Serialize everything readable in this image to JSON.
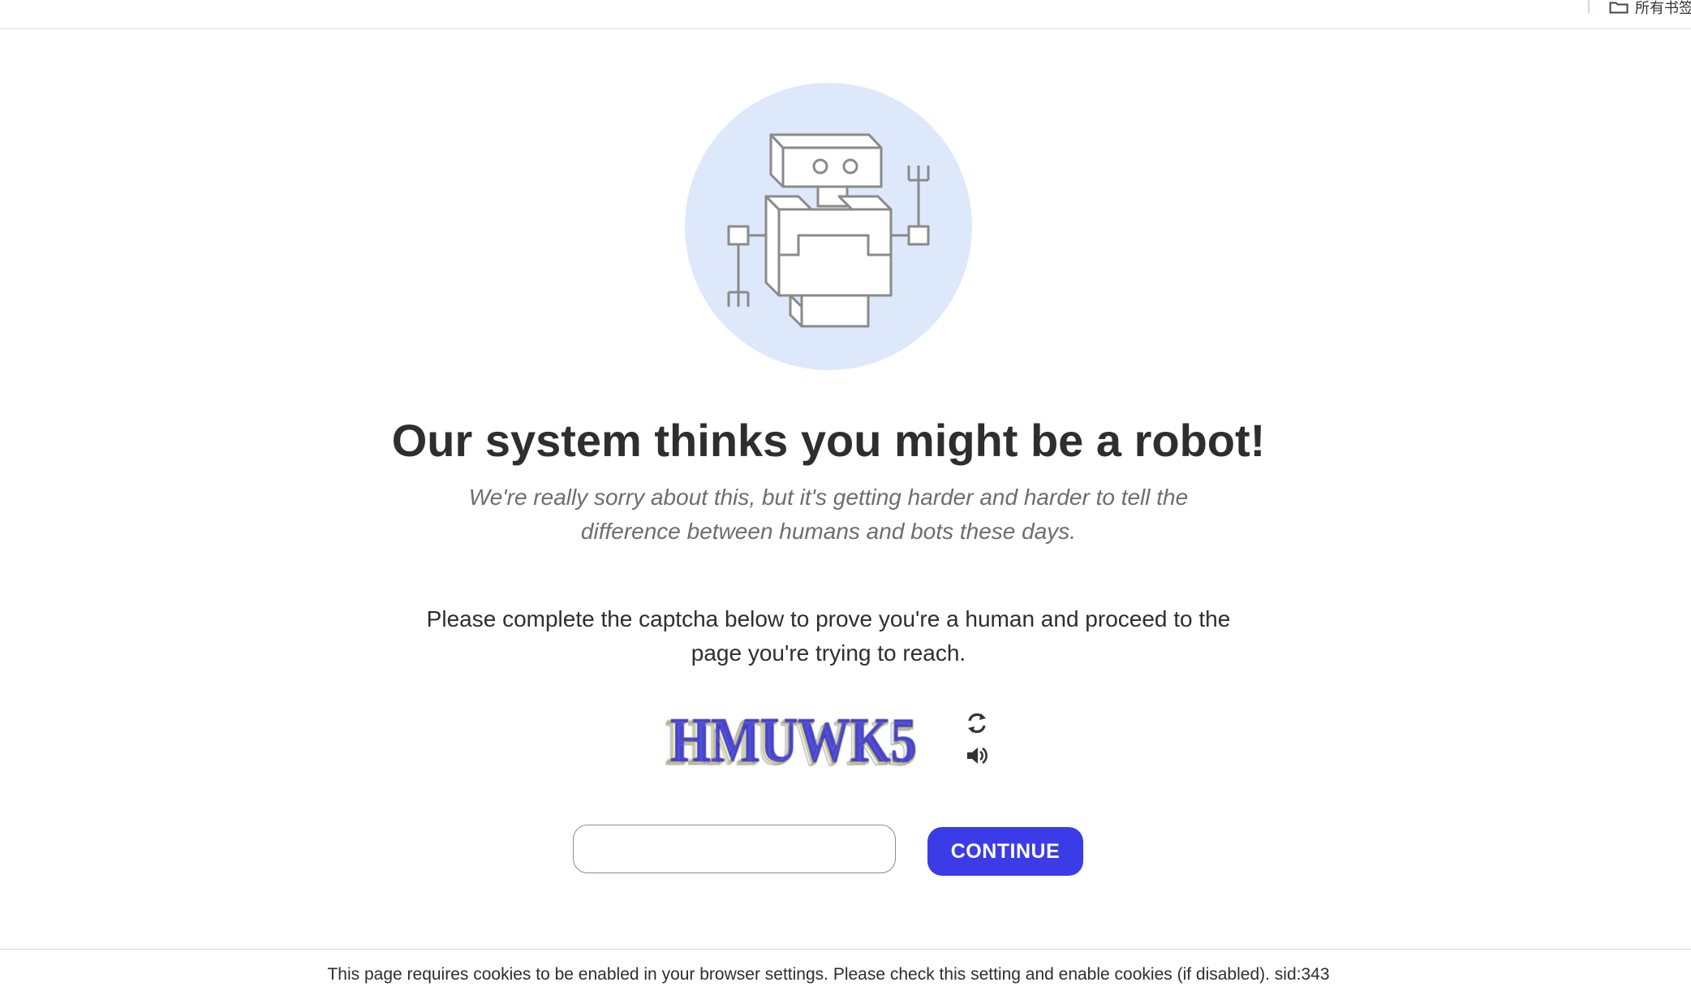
{
  "bookmarks_bar": {
    "folder_label": "所有书签",
    "folder_icon": "folder-icon"
  },
  "hero": {
    "illustration": "robot-illustration",
    "circle_color": "#dde9fb"
  },
  "heading": "Our system thinks you might be a robot!",
  "apology": "We're really sorry about this, but it's getting harder and harder to tell the difference between humans and bots these days.",
  "instructions": "Please complete the captcha below to prove you're a human and proceed to the page you're trying to reach.",
  "captcha": {
    "image_text": "HMUWK5",
    "refresh_icon": "refresh-icon",
    "audio_icon": "audio-icon"
  },
  "form": {
    "input_value": "",
    "input_placeholder": "",
    "button_label": "CONTINUE",
    "button_color": "#3b3be8"
  },
  "footer": {
    "notice": "This page requires cookies to be enabled in your browser settings. Please check this setting and enable cookies (if disabled). sid:343"
  }
}
